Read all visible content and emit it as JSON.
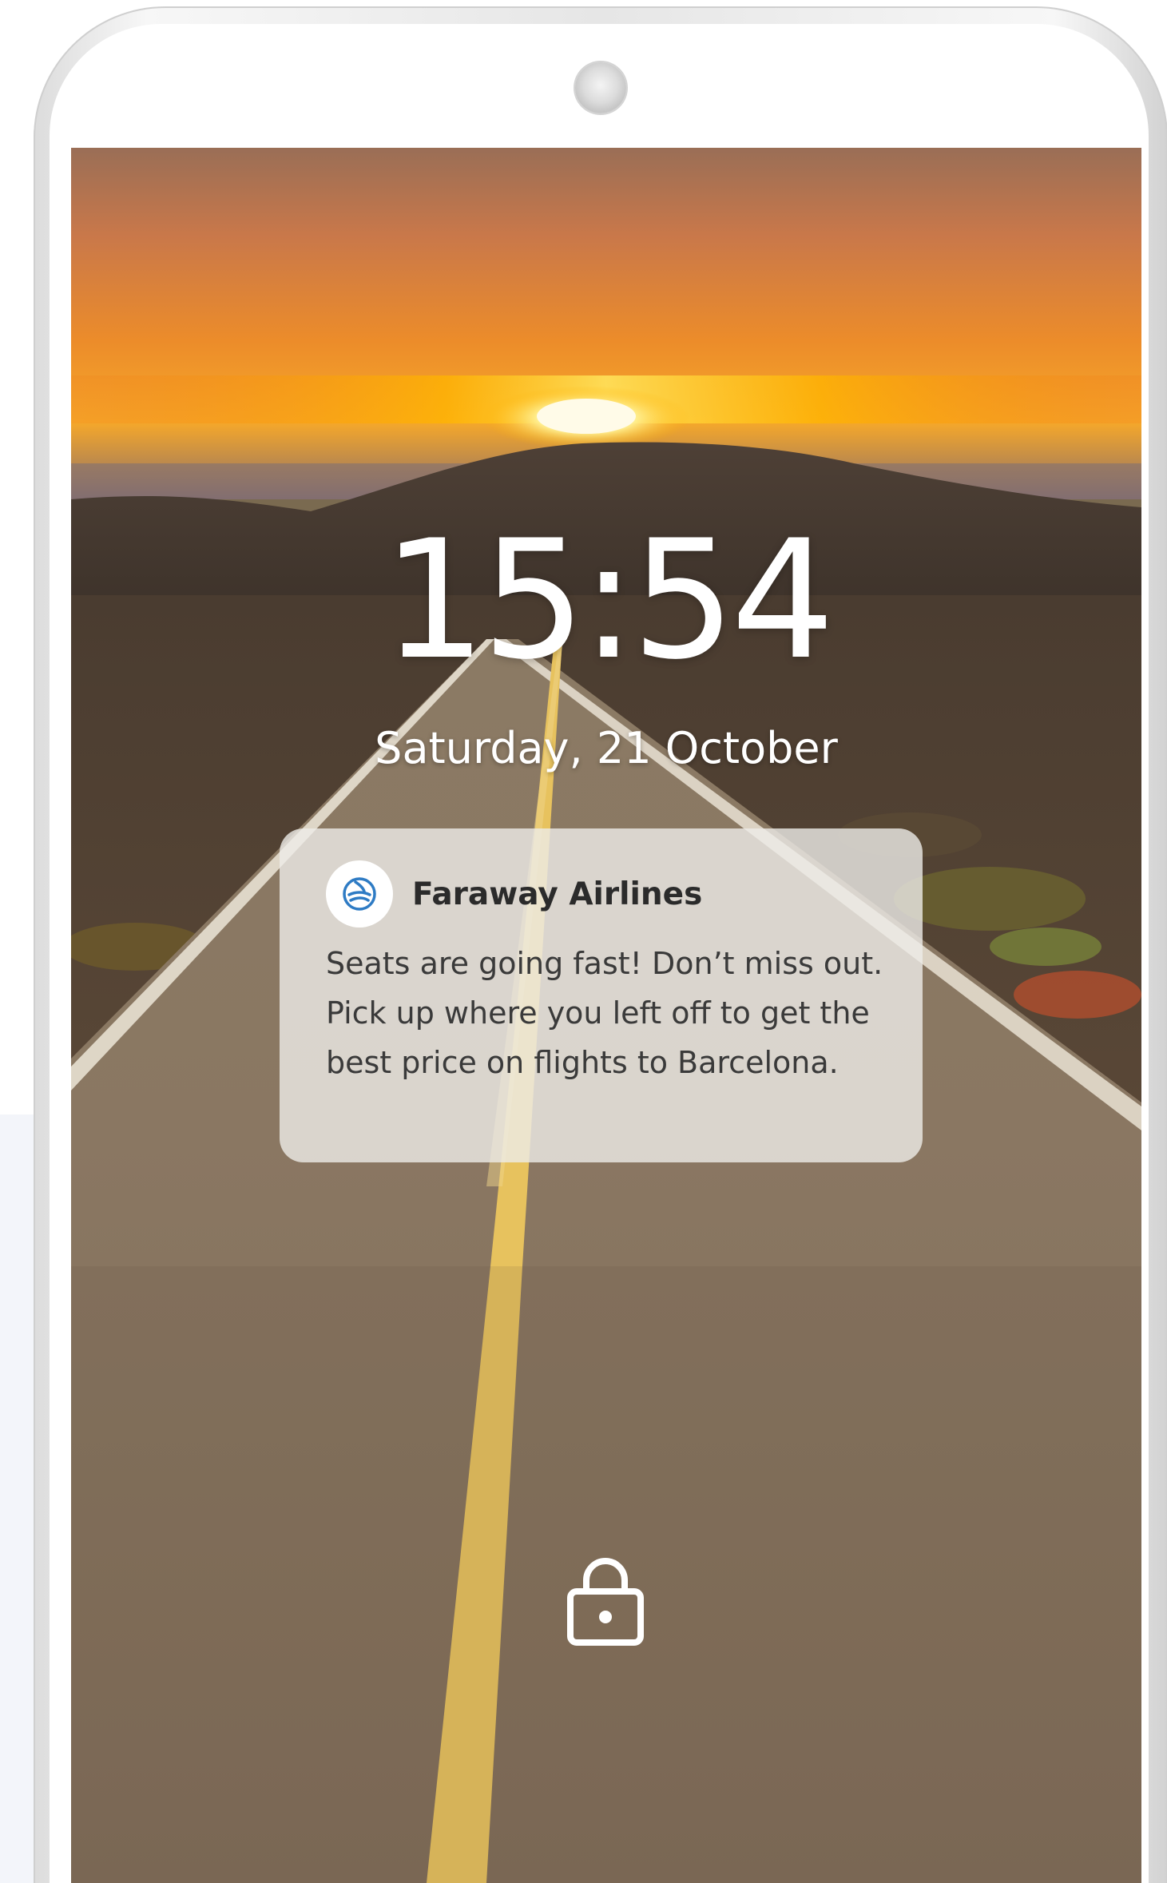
{
  "lockscreen": {
    "time": "15:54",
    "date": "Saturday, 21 October"
  },
  "notification": {
    "app_name": "Faraway Airlines",
    "app_icon": "faraway-airlines-logo-icon",
    "message": "Seats are going fast! Don’t miss out. Pick up where you left off to get the best price on flights to Barcelona."
  },
  "lock_icon": "lock-icon",
  "colors": {
    "notification_bg": "#EEECE8",
    "app_icon_accent": "#2E7BC4",
    "clock_text": "#FFFFFF"
  }
}
